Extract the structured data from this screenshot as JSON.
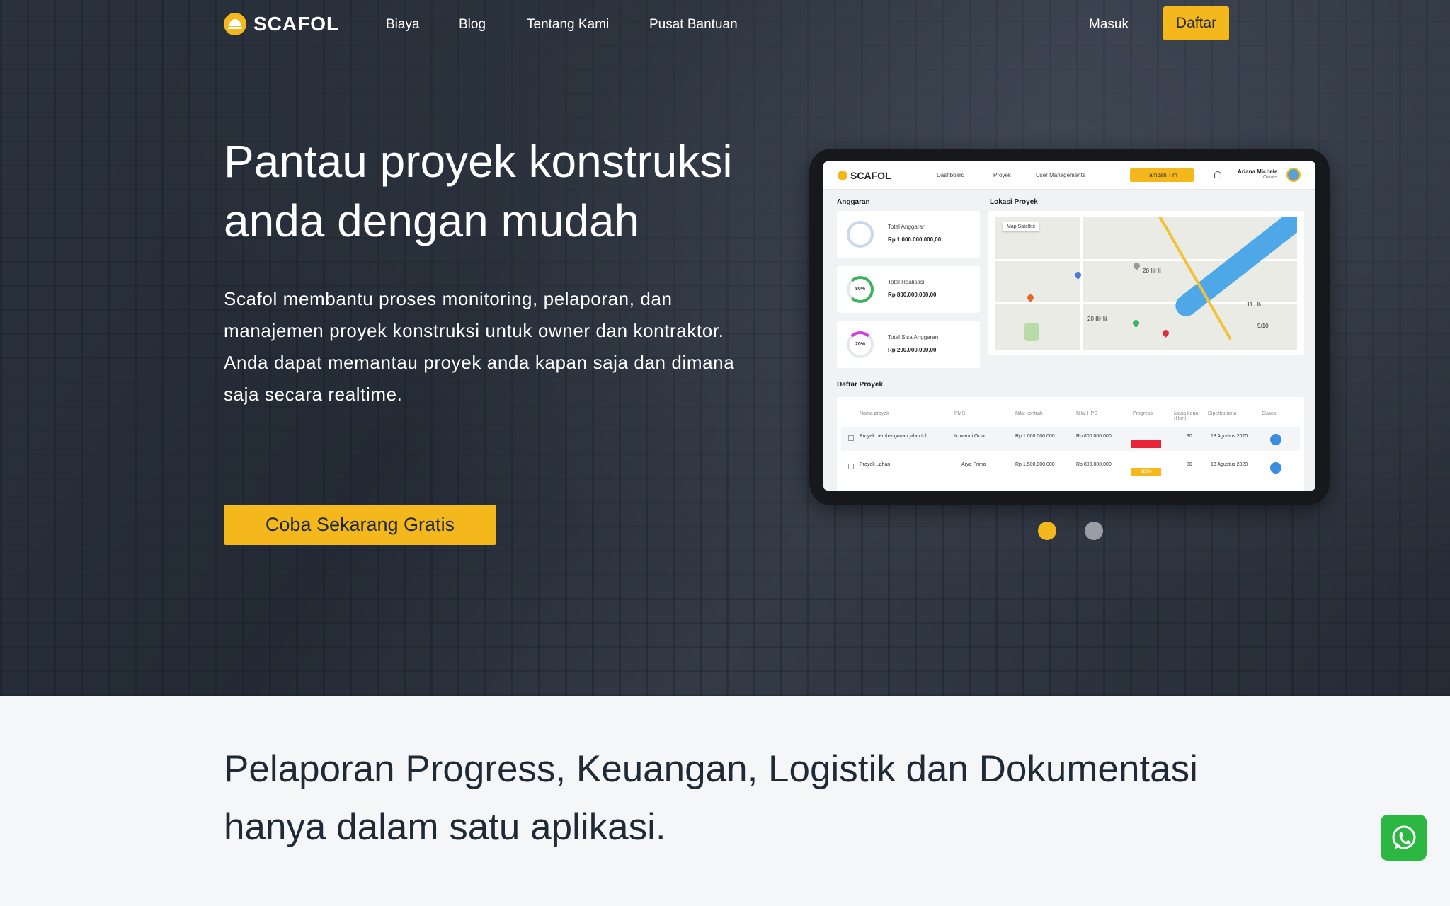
{
  "nav": {
    "logo": "SCAFOL",
    "links": [
      "Biaya",
      "Blog",
      "Tentang Kami",
      "Pusat Bantuan"
    ],
    "login": "Masuk",
    "register": "Daftar"
  },
  "hero": {
    "title_line1": "Pantau proyek konstruksi",
    "title_line2": "anda dengan mudah",
    "description": "Scafol membantu proses monitoring, pelaporan, dan manajemen proyek konstruksi untuk owner dan kontraktor. Anda dapat memantau proyek anda kapan saja dan dimana saja secara realtime.",
    "cta": "Coba Sekarang Gratis"
  },
  "app": {
    "logo": "SCAFOL",
    "nav": [
      "Dashboard",
      "Proyek",
      "User Managements"
    ],
    "tambah": "Tambah Tim",
    "user_name": "Ariana Michele",
    "user_role": "Owner",
    "anggaran_title": "Anggaran",
    "cards": [
      {
        "label": "Total Anggaran",
        "value": "Rp 1.000.000.000,00",
        "ring": ""
      },
      {
        "label": "Total Realisasi",
        "value": "Rp 800.000.000,00",
        "ring": "80%"
      },
      {
        "label": "Total Sisa Anggaran",
        "value": "Rp 200.000.000,00",
        "ring": "20%"
      }
    ],
    "lokasi_title": "Lokasi Proyek",
    "map_tabs": "Map   Satellite",
    "map_labels": [
      "20 Ilir Ii",
      "20 Ilir Iii",
      "11 Ulu",
      "9/10"
    ],
    "daftar_title": "Daftar Proyek",
    "table_headers": [
      "Nama proyek",
      "PMS",
      "Nilai kontrak",
      "Nilai HPS",
      "Progress",
      "Masa kerja (Hari)",
      "Diperbaharui",
      "Cuaca"
    ],
    "rows": [
      {
        "name": "Proyek pembangunan jalan tol",
        "pms": "Ichvandi Octa",
        "kontrak": "Rp 1.000.000.000",
        "hps": "Rp 800.000.000",
        "progress": "",
        "masa": "30",
        "updated": "13 Agustus 2020"
      },
      {
        "name": "Proyek Lahan",
        "pms": "Arya Prima",
        "kontrak": "Rp 1.500.000.000",
        "hps": "Rp 800.000.000",
        "progress": "100%",
        "masa": "30",
        "updated": "13 Agustus 2020"
      }
    ]
  },
  "section2": {
    "title": "Pelaporan Progress, Keuangan, Logistik dan Dokumentasi hanya dalam satu aplikasi."
  },
  "colors": {
    "accent": "#f5b81c",
    "whatsapp": "#2bb741",
    "progress_red": "#e8243a"
  },
  "icons": [
    "logo-icon",
    "bell-icon",
    "whatsapp-icon"
  ]
}
